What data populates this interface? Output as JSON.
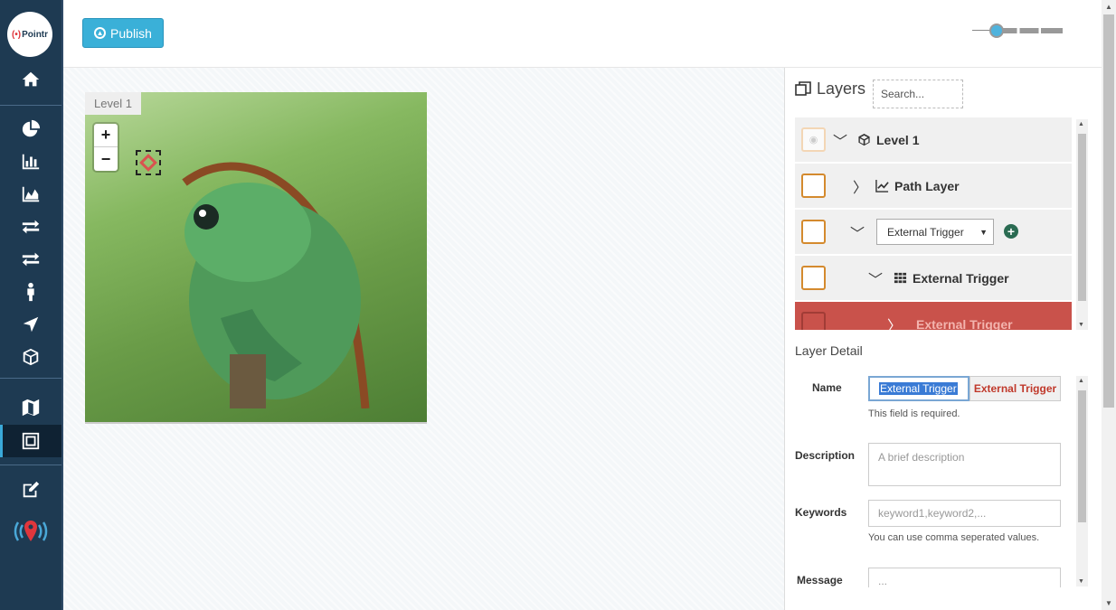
{
  "app": {
    "logo_text": "Pointr",
    "logo_mark": "(•)"
  },
  "sidebar": {
    "items": [
      {
        "icon": "home-icon"
      },
      {
        "icon": "pie-chart-icon"
      },
      {
        "icon": "bar-chart-icon"
      },
      {
        "icon": "area-chart-icon"
      },
      {
        "icon": "transfer-icon"
      },
      {
        "icon": "transfer-icon"
      },
      {
        "icon": "person-icon"
      },
      {
        "icon": "location-arrow-icon"
      },
      {
        "icon": "cube-icon"
      },
      {
        "icon": "map-icon"
      },
      {
        "icon": "map-editor-icon",
        "active": true
      },
      {
        "icon": "edit-icon"
      },
      {
        "icon": "beacon-pin-icon"
      }
    ]
  },
  "toolbar": {
    "publish_label": "Publish"
  },
  "canvas": {
    "level_label": "Level 1",
    "zoom_in": "+",
    "zoom_out": "−"
  },
  "layers": {
    "title": "Layers",
    "search_placeholder": "Search...",
    "tree": [
      {
        "label": "Level 1"
      },
      {
        "label": "Path Layer"
      },
      {
        "select_value": "External Trigger"
      },
      {
        "label": "External Trigger"
      },
      {
        "label": "External Trigger",
        "selected": true
      }
    ]
  },
  "detail": {
    "title": "Layer Detail",
    "name_label": "Name",
    "name_value": "External Trigger",
    "name_addon": "External Trigger",
    "name_help": "This field is required.",
    "description_label": "Description",
    "description_placeholder": "A brief description",
    "keywords_label": "Keywords",
    "keywords_placeholder": "keyword1,keyword2,...",
    "keywords_help": "You can use comma seperated values.",
    "message_label": "Message",
    "message_placeholder": "..."
  },
  "colors": {
    "sidebar": "#1e3a52",
    "publish": "#3ab0d8",
    "selected_row": "#c9524b",
    "checkbox_border": "#d48a2e"
  }
}
